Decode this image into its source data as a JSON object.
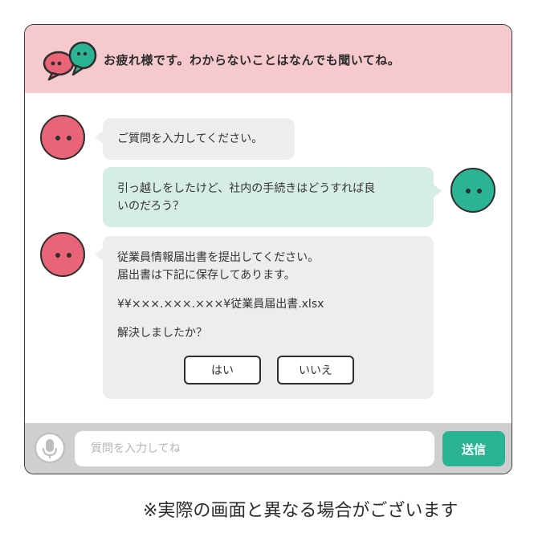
{
  "header": {
    "title": "お疲れ様です。わからないことはなんでも聞いてね。",
    "logo_icon": "chat-bubbles-icon"
  },
  "colors": {
    "header_bg": "#f5c9cd",
    "bot_avatar": "#ea6478",
    "user_avatar": "#2bb493",
    "bot_bubble": "#ededed",
    "user_bubble": "#d6ede4",
    "send_button": "#2bb493"
  },
  "messages": [
    {
      "sender": "bot",
      "lines": [
        "ご質問を入力してください。"
      ]
    },
    {
      "sender": "user",
      "lines": [
        "引っ越しをしたけど、社内の手続きはどうすれば良",
        "いのだろう？"
      ]
    },
    {
      "sender": "bot",
      "lines": [
        "従業員情報届出書を提出してください。",
        "届出書は下記に保存してあります。"
      ],
      "path": "¥¥×××.×××.×××¥従業員届出書.xlsx",
      "question": "解決しましたか？",
      "yes_label": "はい",
      "no_label": "いいえ"
    }
  ],
  "composer": {
    "mic_icon": "microphone-icon",
    "placeholder": "質問を入力してね",
    "value": "",
    "send_label": "送信"
  },
  "note": "※実際の画面と異なる場合がございます"
}
